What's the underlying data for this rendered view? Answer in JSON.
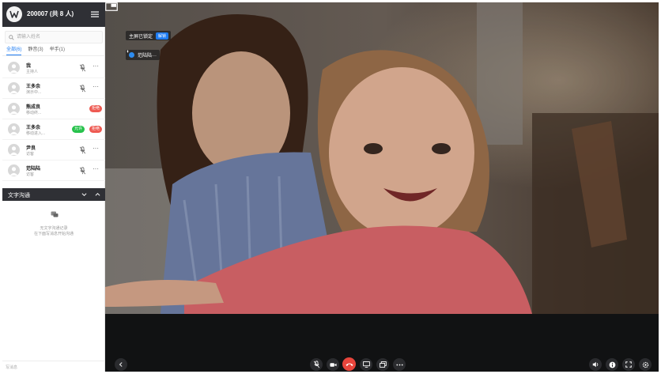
{
  "meeting": {
    "title": "200007 (共 8 人)"
  },
  "search": {
    "placeholder": "请输入姓名"
  },
  "tabs": [
    {
      "label": "全部(6)",
      "active": true
    },
    {
      "label": "静音(3)",
      "active": false
    },
    {
      "label": "举手(1)",
      "active": false
    }
  ],
  "participants": [
    {
      "name": "我",
      "role": "主持人",
      "status": "mic-muted"
    },
    {
      "name": "王多余",
      "role": "演示中...",
      "status": "mic-muted"
    },
    {
      "name": "熊成良",
      "role": "移动终...",
      "badge_red": "拒绝"
    },
    {
      "name": "王多余",
      "role": "移动进入...",
      "badge_green": "允许",
      "badge_red": "拒绝"
    },
    {
      "name": "尹良",
      "role": "访客",
      "status": "mic-muted"
    },
    {
      "name": "范陆陆",
      "role": "访客",
      "status": "mic-muted"
    }
  ],
  "chat": {
    "title": "文字沟通",
    "empty_line1": "无文字沟通记录",
    "empty_line2": "在下面写消息开始沟通",
    "input_placeholder": "写消息"
  },
  "stage": {
    "lock_text": "主屏已锁定",
    "unlock_label": "解锁",
    "speaker_name": "范陆陆···"
  },
  "icons": {
    "logo": "app-logo-icon",
    "menu": "hamburger-menu-icon",
    "search": "search-icon",
    "mic_muted": "mic-off-icon",
    "more": "more-dots-icon",
    "layout": "picture-in-picture-icon",
    "collapse": "chevron-down-icon",
    "expand": "chevron-up-icon",
    "chat_empty": "chat-bubble-icon"
  },
  "colors": {
    "accent": "#1e7cf2",
    "header_bg": "#2f3035",
    "hangup": "#e8453c",
    "badge_red": "#ee5a52",
    "badge_green": "#27c24c"
  }
}
